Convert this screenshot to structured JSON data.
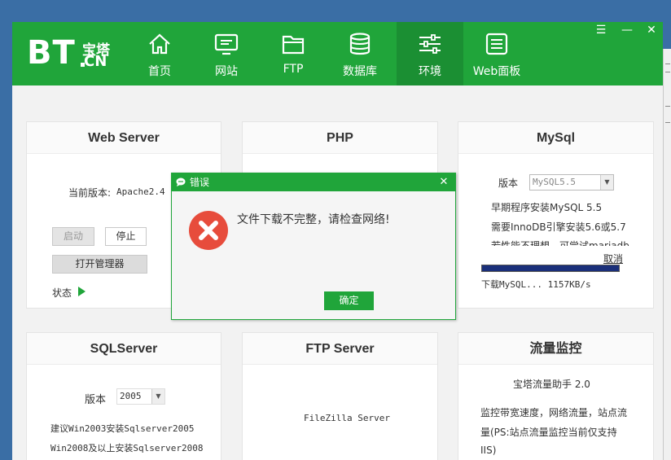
{
  "header": {
    "logo_main": "BT",
    "logo_sub_top": "宝塔",
    "logo_sub_bottom": "CN",
    "nav": [
      {
        "label": "首页",
        "icon": "home-icon"
      },
      {
        "label": "网站",
        "icon": "monitor-icon"
      },
      {
        "label": "FTP",
        "icon": "folder-icon"
      },
      {
        "label": "数据库",
        "icon": "database-icon"
      },
      {
        "label": "环境",
        "icon": "sliders-icon",
        "active": true
      },
      {
        "label": "Web面板",
        "icon": "panel-list-icon"
      }
    ],
    "controls": {
      "menu": "☰",
      "minimize": "—",
      "close": "✕"
    }
  },
  "cards": {
    "web_server": {
      "title": "Web Server",
      "version_label": "当前版本:",
      "version_value": "Apache2.4",
      "start": "启动",
      "stop": "停止",
      "open_manager": "打开管理器",
      "status_label": "状态"
    },
    "php": {
      "title": "PHP"
    },
    "mysql": {
      "title": "MySql",
      "version_label": "版本",
      "version_value": "MySQL5.5",
      "line1": "早期程序安装MySQL 5.5",
      "line2": "需要InnoDB引擎安装5.6或5.7",
      "line3": "若性能不理想，可尝试mariadb",
      "cancel": "取消",
      "progress": 1.0,
      "download_status": "下载MySQL... 1157KB/s"
    },
    "sqlserver": {
      "title": "SQLServer",
      "version_label": "版本",
      "version_value": "2005",
      "line1": "建议Win2003安装Sqlserver2005",
      "line2": "Win2008及以上安装Sqlserver2008"
    },
    "ftp_server": {
      "title": "FTP Server",
      "name": "FileZilla Server"
    },
    "traffic": {
      "title": "流量监控",
      "name": "宝塔流量助手 2.0",
      "line1": "监控带宽速度，网络流量，站点流",
      "line2": "量(PS:站点流量监控当前仅支持",
      "line3": "IIS)"
    }
  },
  "dialog": {
    "title": "错误",
    "message": "文件下载不完整，请检查网络!",
    "ok": "确定",
    "close": "✕"
  },
  "colors": {
    "brand": "#20a53a",
    "brand_dark": "#1b8f33",
    "error": "#e74c3c",
    "progress": "#1a2f7a"
  }
}
